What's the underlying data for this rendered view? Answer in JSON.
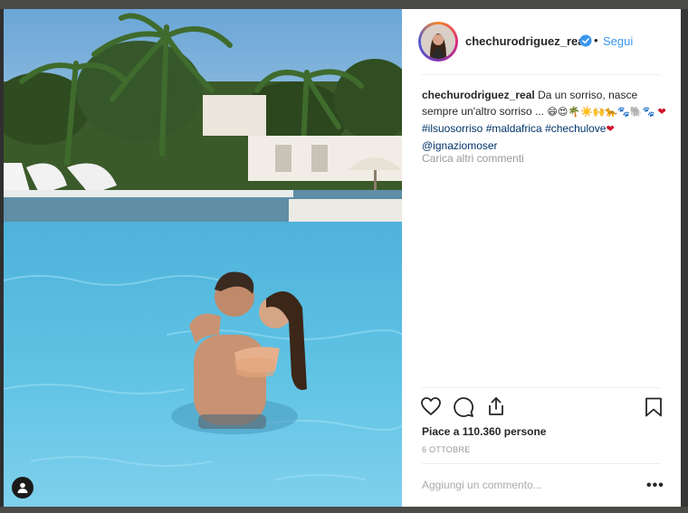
{
  "post": {
    "username": "chechurodriguez_real",
    "follow_label": "Segui",
    "dot": "•",
    "caption": {
      "username": "chechurodriguez_real",
      "text": "Da un sorriso, nasce sempre un'altro sorriso ...",
      "emojis": "😄😍🌴☀️🙌🐆🐾🐘🐾",
      "heart": "❤",
      "hashtags": [
        "#ilsuosorriso",
        "#maldafrica",
        "#chechulove"
      ],
      "heart2": "❤",
      "mention": "@ignaziomoser"
    },
    "load_more_label": "Carica altri commenti",
    "likes_prefix": "Piace a",
    "likes_count": "110.360",
    "likes_suffix": "persone",
    "date": "6 OTTOBRE",
    "comment_placeholder": "Aggiungi un commento...",
    "more_options": "•••"
  },
  "colors": {
    "link": "#3897f0",
    "hashtag": "#003569",
    "text": "#262626",
    "muted": "#999999"
  },
  "icons": [
    "user-tag-icon",
    "verified-icon",
    "heart-icon",
    "comment-icon",
    "share-icon",
    "bookmark-icon",
    "more-options-icon"
  ]
}
